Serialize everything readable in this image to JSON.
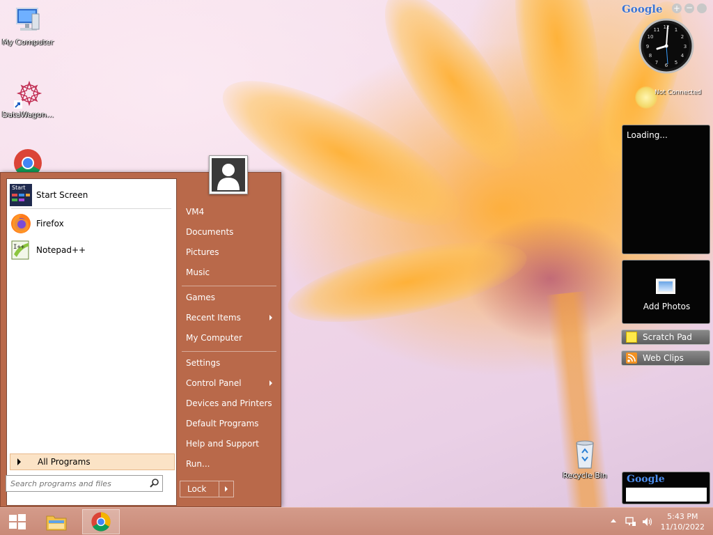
{
  "desktop": {
    "icons": [
      {
        "label": "My Computer",
        "icon": "computer-icon"
      },
      {
        "label": "DataWagon...",
        "icon": "datawagon-icon"
      },
      {
        "label": "Recycle Bin",
        "icon": "recycle-bin-icon"
      }
    ]
  },
  "start_menu": {
    "pinned": [
      {
        "label": "Start Screen",
        "icon": "start-screen-icon"
      },
      {
        "label": "Firefox",
        "icon": "firefox-icon"
      },
      {
        "label": "Notepad++",
        "icon": "notepadpp-icon"
      }
    ],
    "start_icon_text": "Start",
    "all_programs": "All Programs",
    "search_placeholder": "Search programs and files",
    "right_items": {
      "user": "VM4",
      "documents": "Documents",
      "pictures": "Pictures",
      "music": "Music",
      "games": "Games",
      "recent_items": "Recent Items",
      "my_computer": "My Computer",
      "settings": "Settings",
      "control_panel": "Control Panel",
      "devices_printers": "Devices and Printers",
      "default_programs": "Default Programs",
      "help_support": "Help and Support",
      "run": "Run..."
    },
    "lock": "Lock"
  },
  "gadgets": {
    "google_logo": "Google",
    "weather_status": "Not Connected",
    "feed_status": "Loading...",
    "add_photos": "Add Photos",
    "scratch_pad": "Scratch Pad",
    "web_clips": "Web Clips",
    "google_search_logo": "Google",
    "clock_time": "8:25"
  },
  "taskbar": {
    "time": "5:43 PM",
    "date": "11/10/2022",
    "apps": [
      "start-button",
      "file-explorer-icon",
      "chrome-icon"
    ]
  },
  "colors": {
    "start_menu_bg": "#b9694a",
    "taskbar_bg": "#c98a78",
    "all_programs_highlight": "#fbe3c6"
  }
}
